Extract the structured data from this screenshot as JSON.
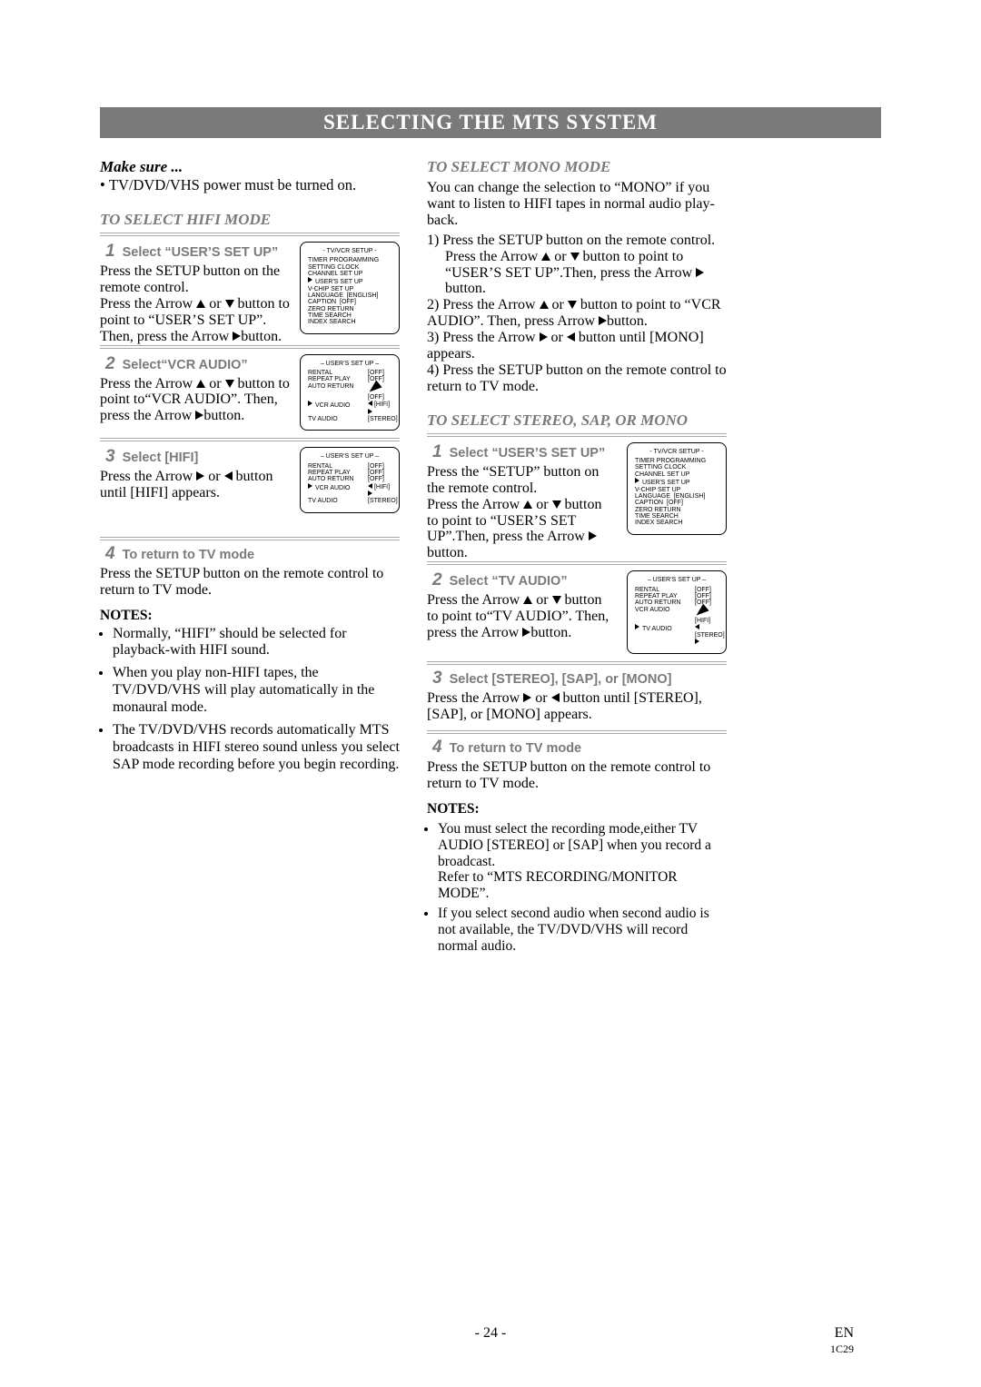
{
  "title": "SELECTING THE MTS SYSTEM",
  "makeSure": "Make sure ...",
  "powerNote": "TV/DVD/VHS power must be turned on.",
  "hifiHeading": "TO SELECT HIFI MODE",
  "monoHeading": "TO SELECT MONO MODE",
  "stereoHeading": "TO SELECT STEREO, SAP, OR MONO",
  "steps": {
    "s1": "Select “USER’S SET UP”",
    "s1b": "Press the SETUP button on the remote control.",
    "s1c": "Press the Arrow ",
    "s1d": " button to point to “USER’S SET UP”. Then, press the Arrow ",
    "s1e": "button.",
    "s2": "Select“VCR AUDIO”",
    "s2b": "Press the Arrow ",
    "s2c": " button to point to“VCR AUDIO”. Then, press the Arrow ",
    "s2d": "button.",
    "s3": "Select [HIFI]",
    "s3b": "Press the Arrow ",
    "s3c": " button until [HIFI] appears.",
    "s4": "To return to TV mode",
    "s4b": "Press the SETUP button on the remote control to return to TV mode."
  },
  "notesHd": "NOTES:",
  "notesL": [
    "Normally, “HIFI” should be selected for playback-with HIFI sound.",
    "When you play non-HIFI tapes, the TV/DVD/VHS will play automatically in the monaural mode.",
    "The TV/DVD/VHS records automatically MTS broadcasts in HIFI stereo sound unless you select SAP mode recording before you begin recording."
  ],
  "mono": {
    "p": "You can change the selection to “MONO” if you want to listen to HIFI tapes in normal audio play-back.",
    "l1": "1) Press the SETUP button on the remote control.",
    "l1b": "Press the Arrow ",
    "l1c": " button to point to “USER’S SET UP”.Then, press the Arrow ",
    "l1d": " button.",
    "l2": "2) Press the Arrow ",
    "l2b": " button to point to “VCR AUDIO”. Then, press Arrow ",
    "l2c": "button.",
    "l3": "3) Press the Arrow ",
    "l3b": " button until [MONO] appears.",
    "l4": "4) Press the SETUP button on the remote control to return to TV mode."
  },
  "rsteps": {
    "s1": "Select “USER’S SET UP”",
    "s1b": "Press the “SETUP” button on the remote control.",
    "s1c": "Press the Arrow ",
    "s1d": " button to point to “USER’S SET UP”.Then, press the Arrow ",
    "s1e": " button.",
    "s2": "Select “TV AUDIO”",
    "s2b": "Press the Arrow ",
    "s2c": " button to point to“TV AUDIO”. Then, press the Arrow ",
    "s2d": "button.",
    "s3": "Select [STEREO], [SAP], or [MONO]",
    "s3b": "Press the Arrow ",
    "s3c": " button until [STEREO], [SAP], or [MONO] appears.",
    "s4": "To return to TV mode",
    "s4b": "Press the SETUP button on the remote control to return to TV mode."
  },
  "notesR": {
    "n1": "You must select the recording mode,either TV AUDIO [STEREO] or [SAP] when you record a broadcast.",
    "n1b": "Refer to “MTS RECORDING/MONITOR MODE”.",
    "n2": "If you select second audio when second audio is not available, the TV/DVD/VHS will record normal audio."
  },
  "osd": {
    "tvvcr": "- TV/VCR SETUP -",
    "tvvcrItems": [
      "TIMER PROGRAMMING",
      "SETTING CLOCK",
      "CHANNEL SET UP",
      "USER’S SET UP",
      "V-CHIP SET UP",
      "LANGUAGE   [ENGLISH]",
      "CAPTION   [OFF]",
      "ZERO RETURN",
      "TIME SEARCH",
      "INDEX SEARCH"
    ],
    "user": "– USER’S SET UP –",
    "rental": "RENTAL",
    "repeat": "REPEAT PLAY",
    "autoret": "AUTO RETURN",
    "vcraud": "VCR AUDIO",
    "tvaud": "TV AUDIO",
    "off": "[OFF]",
    "hifi": "[HIFI]",
    "stereo": "[STEREO]"
  },
  "page": "- 24 -",
  "en": "EN",
  "code": "1C29"
}
